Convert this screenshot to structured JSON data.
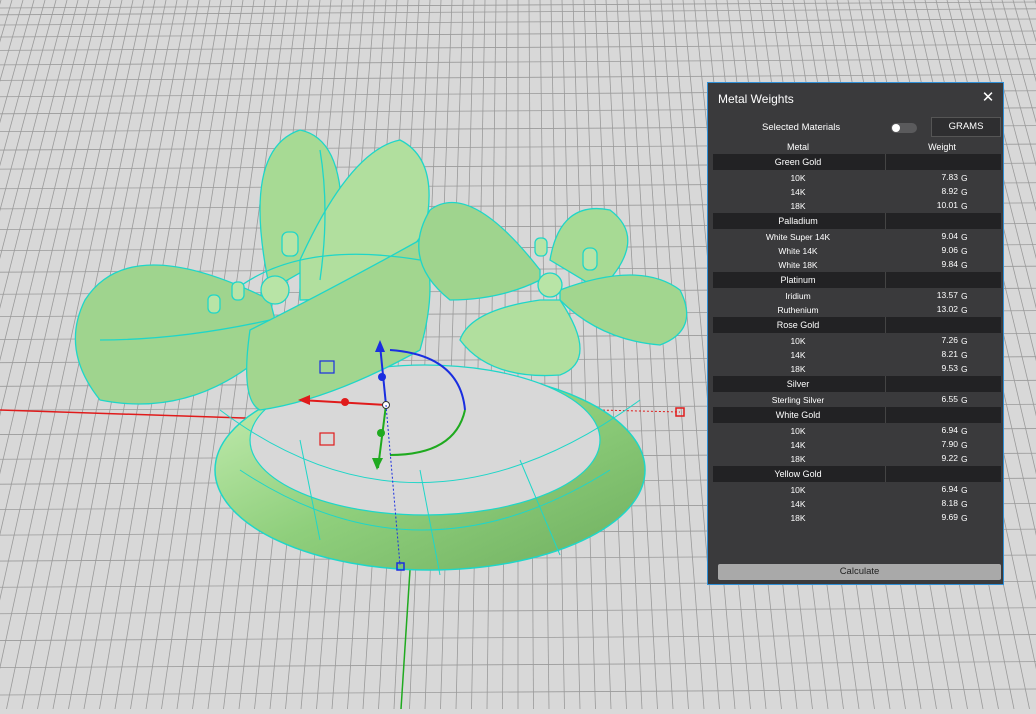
{
  "panel": {
    "title": "Metal Weights",
    "close_icon": "close-icon",
    "selected_materials_label": "Selected Materials",
    "selected_materials_on": false,
    "units_label": "GRAMS",
    "col_metal": "Metal",
    "col_weight": "Weight",
    "calculate_label": "Calculate",
    "accent_color": "#2f8fd6",
    "categories": [
      {
        "name": "Green Gold",
        "items": [
          {
            "name": "10K",
            "value": "7.83",
            "unit": "G"
          },
          {
            "name": "14K",
            "value": "8.92",
            "unit": "G"
          },
          {
            "name": "18K",
            "value": "10.01",
            "unit": "G"
          }
        ]
      },
      {
        "name": "Palladium",
        "items": [
          {
            "name": "White Super 14K",
            "value": "9.04",
            "unit": "G"
          },
          {
            "name": "White 14K",
            "value": "9.06",
            "unit": "G"
          },
          {
            "name": "White 18K",
            "value": "9.84",
            "unit": "G"
          }
        ]
      },
      {
        "name": "Platinum",
        "items": [
          {
            "name": "Iridium",
            "value": "13.57",
            "unit": "G"
          },
          {
            "name": "Ruthenium",
            "value": "13.02",
            "unit": "G"
          }
        ]
      },
      {
        "name": "Rose Gold",
        "items": [
          {
            "name": "10K",
            "value": "7.26",
            "unit": "G"
          },
          {
            "name": "14K",
            "value": "8.21",
            "unit": "G"
          },
          {
            "name": "18K",
            "value": "9.53",
            "unit": "G"
          }
        ]
      },
      {
        "name": "Silver",
        "items": [
          {
            "name": "Sterling Silver",
            "value": "6.55",
            "unit": "G"
          }
        ]
      },
      {
        "name": "White Gold",
        "items": [
          {
            "name": "10K",
            "value": "6.94",
            "unit": "G"
          },
          {
            "name": "14K",
            "value": "7.90",
            "unit": "G"
          },
          {
            "name": "18K",
            "value": "9.22",
            "unit": "G"
          }
        ]
      },
      {
        "name": "Yellow Gold",
        "items": [
          {
            "name": "10K",
            "value": "6.94",
            "unit": "G"
          },
          {
            "name": "14K",
            "value": "8.18",
            "unit": "G"
          },
          {
            "name": "18K",
            "value": "9.69",
            "unit": "G"
          }
        ]
      }
    ]
  },
  "viewport": {
    "background_color": "#d9d9d9",
    "grid_color": "#9a9a9a",
    "model_color": "#9fd48e",
    "edge_color": "#1fd6c8",
    "x_axis_color": "#e01b1b",
    "y_axis_color": "#1faa1f",
    "z_axis_color": "#1a2ee0"
  }
}
